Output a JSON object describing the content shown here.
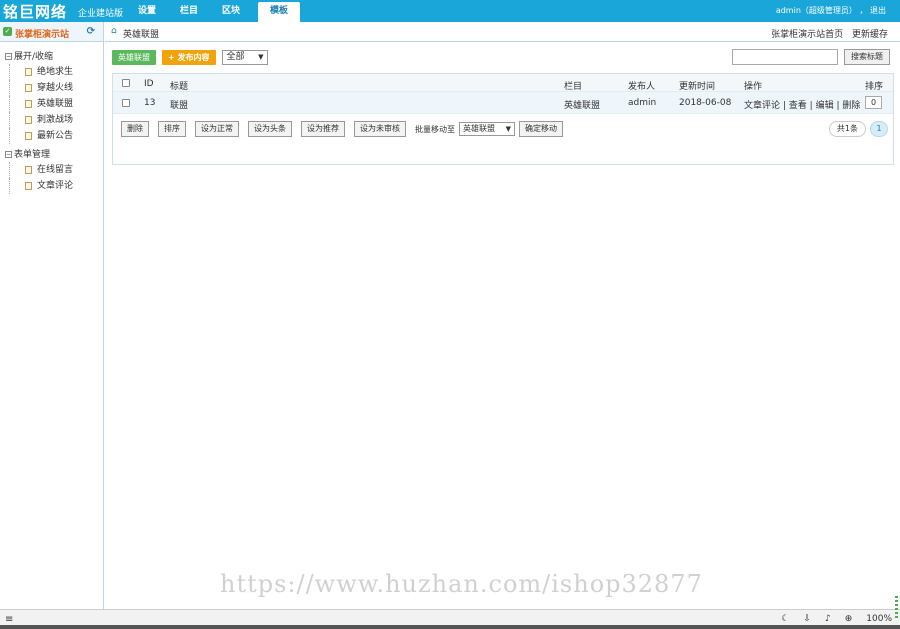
{
  "topbar": {
    "brand": "铭巨网络",
    "edition": "企业建站版",
    "nav": [
      "设置",
      "栏目",
      "区块",
      "模板"
    ],
    "active_nav": "模板",
    "user": "admin（超级管理员）",
    "logout": "退出"
  },
  "sidebar": {
    "site_name": "张掌柜演示站",
    "groups": [
      {
        "label": "展开/收缩",
        "items": [
          "绝地求生",
          "穿越火线",
          "英雄联盟",
          "刺激战场",
          "最新公告"
        ]
      },
      {
        "label": "表单管理",
        "items": [
          "在线留言",
          "文章评论"
        ]
      }
    ]
  },
  "breadcrumb": {
    "current": "英雄联盟",
    "links": [
      "张掌柜演示站首页",
      "更新缓存"
    ]
  },
  "toolbar": {
    "category_button": "英雄联盟",
    "publish_button": "发布内容",
    "filter_value": "全部",
    "search_button": "搜索标题"
  },
  "table": {
    "headers": {
      "id": "ID",
      "title": "标题",
      "column": "栏目",
      "author": "发布人",
      "updated": "更新时间",
      "ops": "操作",
      "sort": "排序"
    },
    "rows": [
      {
        "id": "13",
        "title": "联盟",
        "column": "英雄联盟",
        "author": "admin",
        "updated": "2018-06-08",
        "ops": [
          "文章评论",
          "查看",
          "编辑",
          "删除"
        ],
        "sort": "0"
      }
    ]
  },
  "actions": {
    "buttons": [
      "删除",
      "排序",
      "设为正常",
      "设为头条",
      "设为推荐",
      "设为未审核"
    ],
    "batch_label": "批量移动至",
    "batch_target": "英雄联盟",
    "confirm_move": "确定移动"
  },
  "pager": {
    "total": "共1条",
    "page": "1"
  },
  "watermark": "https://www.huzhan.com/ishop32877",
  "statusbar": {
    "zoom": "100%"
  }
}
